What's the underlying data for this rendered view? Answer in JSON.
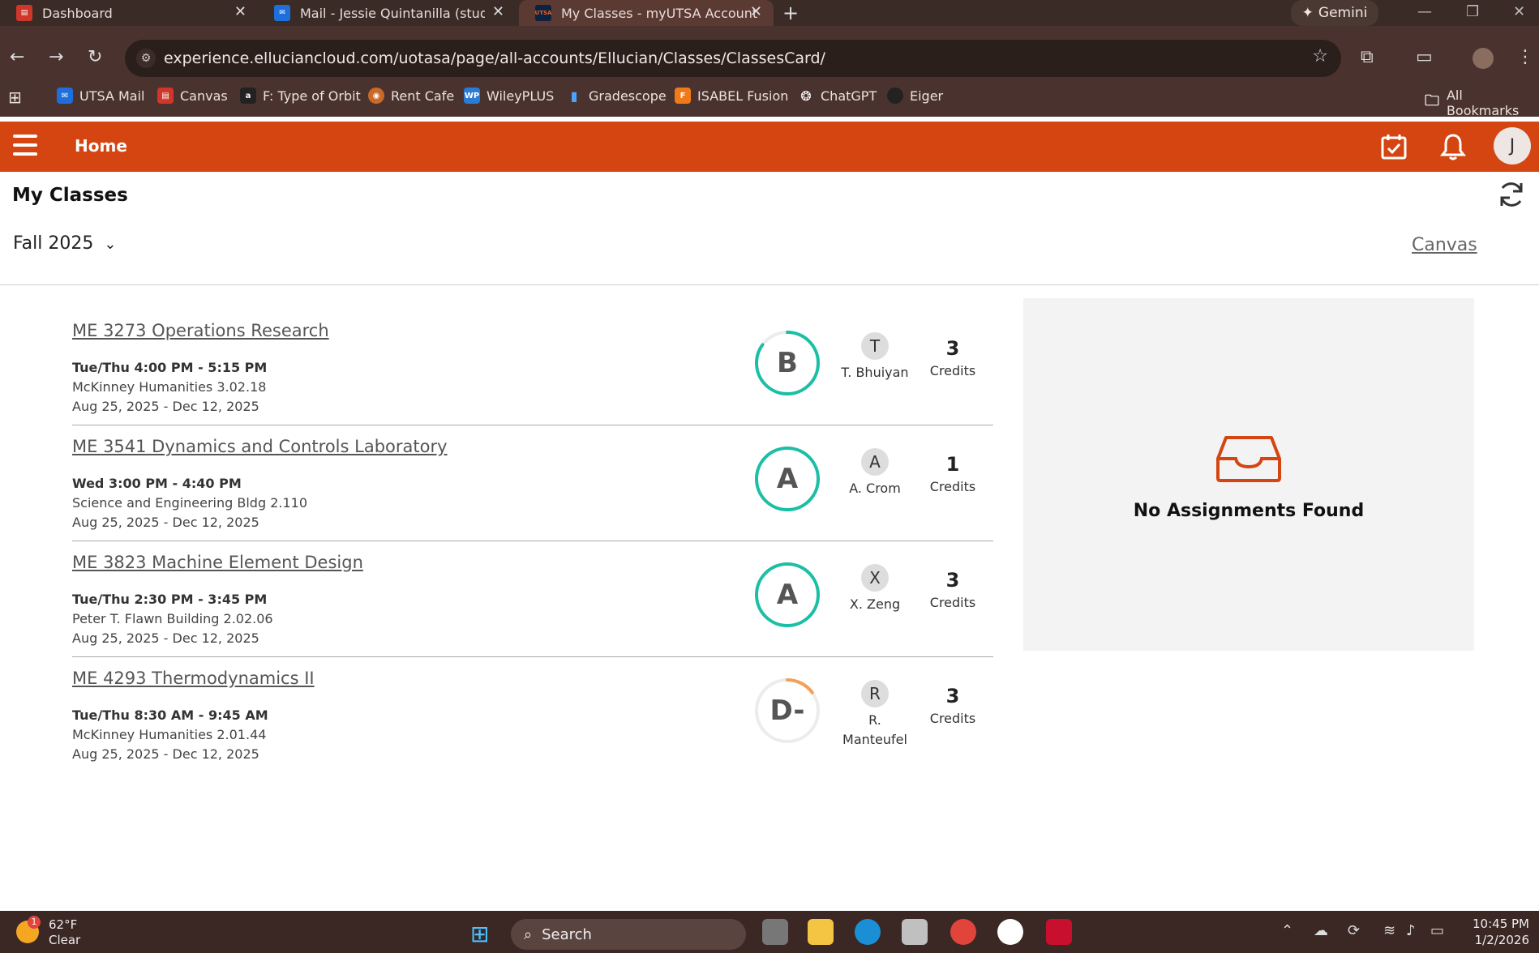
{
  "browser": {
    "tabs": [
      {
        "title": "Dashboard",
        "favicon": "canvas"
      },
      {
        "title": "Mail - Jessie Quintanilla (studen",
        "favicon": "outlook"
      },
      {
        "title": "My Classes - myUTSA Account",
        "favicon": "utsa"
      }
    ],
    "gemini_label": "Gemini",
    "url": "experience.elluciancloud.com/uotasa/page/all-accounts/Ellucian/Classes/ClassesCard/",
    "bookmarks": [
      "UTSA Mail",
      "Canvas",
      "F: Type of Orbit",
      "Rent Cafe",
      "WileyPLUS",
      "Gradescope",
      "ISABEL Fusion",
      "ChatGPT",
      "Eiger"
    ],
    "all_bookmarks": "All Bookmarks"
  },
  "app": {
    "header": {
      "home_label": "Home",
      "avatar_initial": "J"
    },
    "page_title": "My Classes",
    "term": "Fall 2025",
    "canvas_link": "Canvas",
    "courses": [
      {
        "title": "ME 3273 Operations Research",
        "time": "Tue/Thu 4:00 PM - 5:15 PM",
        "location": "McKinney Humanities 3.02.18",
        "dates": "Aug 25, 2025 - Dec 12, 2025",
        "grade": "B",
        "grade_progress": 0.85,
        "grade_color": "#1bbfa6",
        "instructor_initial": "T",
        "instructor_name": "T. Bhuiyan",
        "credits": "3",
        "credits_label": "Credits"
      },
      {
        "title": "ME 3541 Dynamics and Controls Laboratory",
        "time": "Wed 3:00 PM - 4:40 PM",
        "location": "Science and Engineering Bldg 2.110",
        "dates": "Aug 25, 2025 - Dec 12, 2025",
        "grade": "A",
        "grade_progress": 1.0,
        "grade_color": "#1bbfa6",
        "instructor_initial": "A",
        "instructor_name": "A. Crom",
        "credits": "1",
        "credits_label": "Credits"
      },
      {
        "title": "ME 3823 Machine Element Design",
        "time": "Tue/Thu 2:30 PM - 3:45 PM",
        "location": "Peter T. Flawn Building 2.02.06",
        "dates": "Aug 25, 2025 - Dec 12, 2025",
        "grade": "A",
        "grade_progress": 1.0,
        "grade_color": "#1bbfa6",
        "instructor_initial": "X",
        "instructor_name": "X. Zeng",
        "credits": "3",
        "credits_label": "Credits"
      },
      {
        "title": "ME 4293 Thermodynamics II",
        "time": "Tue/Thu 8:30 AM - 9:45 AM",
        "location": "McKinney Humanities 2.01.44",
        "dates": "Aug 25, 2025 - Dec 12, 2025",
        "grade": "D-",
        "grade_progress": 0.15,
        "grade_color": "#f2a05a",
        "instructor_initial": "R",
        "instructor_name": "R. Manteufel",
        "credits": "3",
        "credits_label": "Credits"
      }
    ],
    "assignments": {
      "empty_message": "No Assignments Found"
    }
  },
  "taskbar": {
    "weather_temp": "62°F",
    "weather_cond": "Clear",
    "weather_badge": "1",
    "search_label": "Search",
    "time": "10:45 PM",
    "date": "1/2/2026"
  },
  "colors": {
    "brand": "#d44511",
    "teal": "#1bbfa6"
  }
}
